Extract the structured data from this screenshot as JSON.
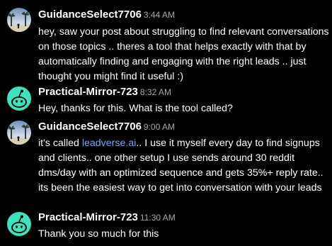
{
  "messages": [
    {
      "username": "GuidanceSelect7706",
      "time": "3:44 AM",
      "avatar": "beach-photo-avatar",
      "text": "hey, saw your post about struggling to find relevant conversations on those topics .. theres a tool that helps exactly with that by automatically finding and engaging with the right leads .. just thought you might find it useful :)"
    },
    {
      "username": "Practical-Mirror-723",
      "time": "8:32 AM",
      "avatar": "snoo-avatar",
      "text": "Hey, thanks for this. What is the tool called?"
    },
    {
      "username": "GuidanceSelect7706",
      "time": "9:00 AM",
      "avatar": "beach-photo-avatar",
      "text_before": "it's called ",
      "link": "leadverse.ai",
      "text_after": ".. I use it myself every day to find signups and clients.. one other setup I use sends around 30 reddit dms/day with an optimized sequence and gets 35%+ reply rate.. its been the easiest way to get into conversation with your leads"
    },
    {
      "username": "Practical-Mirror-723",
      "time": "11:30 AM",
      "avatar": "snoo-avatar",
      "text": "Thank you so much for this"
    }
  ],
  "colors": {
    "background": "#000000",
    "text": "#ffffff",
    "timestamp": "#a7a7a7",
    "link": "#7aa3ff",
    "snoo_avatar_bg": "#3be3c0"
  }
}
